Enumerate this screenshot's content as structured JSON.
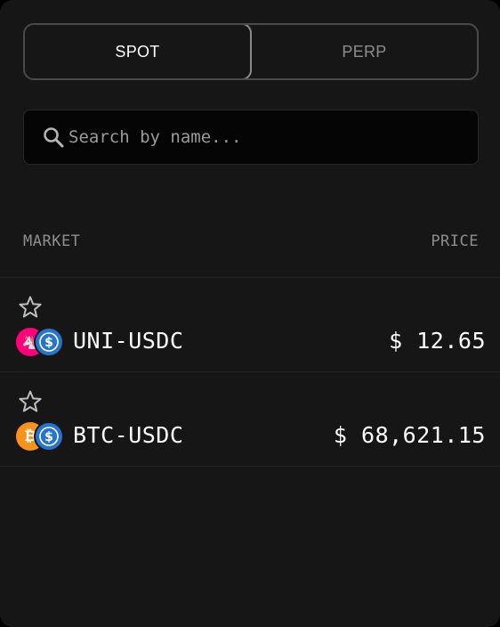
{
  "tabs": [
    {
      "label": "SPOT",
      "active": true
    },
    {
      "label": "PERP",
      "active": false
    }
  ],
  "search": {
    "placeholder": "Search by name...",
    "value": "",
    "icon": "search-icon"
  },
  "columns": {
    "market": "MARKET",
    "price": "PRICE"
  },
  "markets": [
    {
      "name": "UNI-USDC",
      "price": "$ 12.65",
      "base_icon": "uni-icon",
      "quote_icon": "usdc-icon",
      "favorite": false
    },
    {
      "name": "BTC-USDC",
      "price": "$ 68,621.15",
      "base_icon": "btc-icon",
      "quote_icon": "usdc-icon",
      "favorite": false
    }
  ],
  "colors": {
    "background": "#161616",
    "uni": "#ff007a",
    "btc": "#f7931a",
    "usdc": "#2775ca"
  }
}
